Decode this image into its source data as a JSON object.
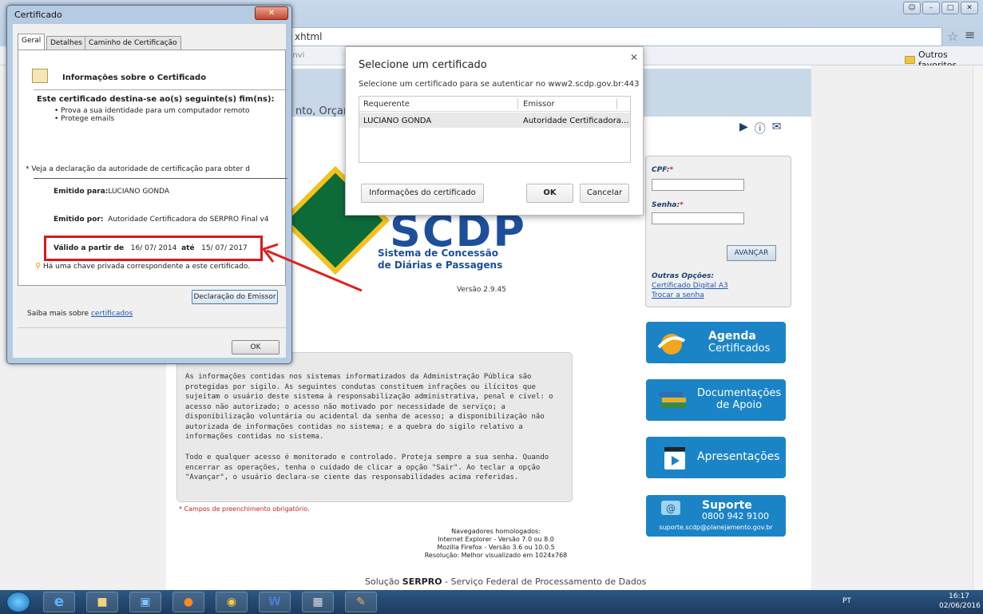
{
  "browser": {
    "address": "xhtml",
    "bookmark_partial": "Envi",
    "other_favorites": "Outros favoritos"
  },
  "page": {
    "banner_text": "nto, Orçam",
    "logo": {
      "name": "SCDP",
      "sub1": "Sistema de Concessão",
      "sub2": "de Diárias e Passagens"
    },
    "version": "Versão 2.9.45",
    "login": {
      "cpf_label": "CPF:",
      "senha_label": "Senha:",
      "required_mark": "*",
      "avancar": "AVANÇAR",
      "outras_opcoes": "Outras Opções:",
      "link_a3": "Certificado Digital A3",
      "link_trocar": "Trocar a senha"
    },
    "tiles": {
      "agenda_title": "Agenda",
      "agenda_sub": "Certificados",
      "docs_title": "Documentações",
      "docs_sub": "de Apoio",
      "apresentacoes": "Apresentações",
      "suporte_title": "Suporte",
      "suporte_phone": "0800 942 9100",
      "suporte_email": "suporte.scdp@planejamento.gov.br"
    },
    "info_p1": "As informações contidas nos sistemas informatizados da Administração Pública são protegidas por sigilo. As seguintes condutas constituem infrações ou ilícitos que sujeitam o usuário deste sistema à responsabilização administrativa, penal e cível: o acesso não autorizado; o acesso não motivado por necessidade de serviço; a disponibilização voluntária ou acidental da senha de acesso; a disponibilização não autorizada de informações contidas no sistema; e a quebra do sigilo relativo a informações contidas no sistema.",
    "info_p2": "Todo e qualquer acesso é monitorado e controlado. Proteja sempre a sua senha. Quando encerrar as operações, tenha o cuidado de clicar a opção \"Sair\". Ao teclar a opção \"Avançar\", o usuário declara-se ciente das responsabilidades acima referidas.",
    "campos": "* Campos de preenchimento obrigatório.",
    "navegadores": [
      "Navegadores homologados:",
      "Internet Explorer - Versão 7.0 ou 8.0",
      "Mozilla Firefox - Versão 3.6 ou 10.0.5",
      "Resolução: Melhor visualizado em 1024x768"
    ],
    "solucao_pre": "Solução",
    "solucao_brand": "SERPRO",
    "solucao_post": "- Serviço Federal de Processamento de Dados"
  },
  "cert_dialog": {
    "title": "Certificado",
    "tabs": [
      "Geral",
      "Detalhes",
      "Caminho de Certificação"
    ],
    "info_title": "Informações sobre o Certificado",
    "destination": "Este certificado destina-se ao(s) seguinte(s) fim(ns):",
    "bullets": [
      "• Prova a sua identidade para um computador remoto",
      "• Protege emails"
    ],
    "declaration": "* Veja a declaração da autoridade de certificação para obter d",
    "issued_to_label": "Emitido para:",
    "issued_to": "LUCIANO GONDA",
    "issued_by_label": "Emitido por:",
    "issued_by": "Autoridade Certificadora do SERPRO Final v4",
    "valid_from_label": "Válido a partir de",
    "valid_from": "16/ 07/ 2014",
    "valid_to_label": "até",
    "valid_to": "15/ 07/ 2017",
    "private_key": "Há uma chave privada correspondente a este certificado.",
    "issuer_button": "Declaração do Emissor",
    "learn_more": "Saiba mais sobre",
    "learn_more_link": "certificados",
    "ok": "OK"
  },
  "select_dialog": {
    "title": "Selecione um certificado",
    "subtitle": "Selecione um certificado para se autenticar no www2.scdp.gov.br:443",
    "col_requester": "Requerente",
    "col_issuer": "Emissor",
    "row_requester": "LUCIANO GONDA",
    "row_issuer": "Autoridade Certificadora...",
    "info_button": "Informações do certificado",
    "ok": "OK",
    "cancel": "Cancelar"
  },
  "taskbar": {
    "lang": "PT",
    "time": "16:17",
    "date": "02/06/2016"
  },
  "colors": {
    "accent_blue": "#1b84c6",
    "highlight_red": "#d7191b",
    "brand_blue": "#1d4f9a"
  }
}
